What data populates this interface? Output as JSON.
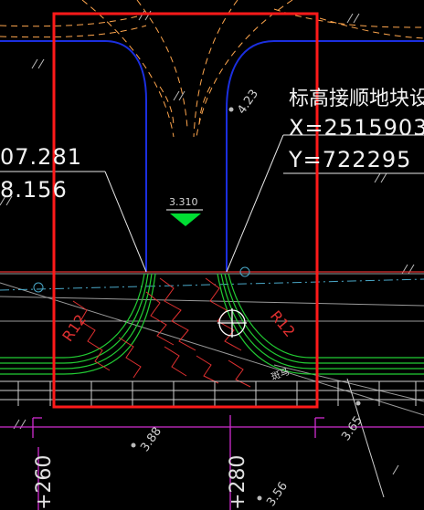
{
  "drawing": {
    "background": "#000000",
    "selection_box_color": "#ff1a1a",
    "text_color": "#f2f2f2",
    "curb_color": "#1b2fe0",
    "road_marking_color": "#ffa64d",
    "green_line_color": "#22cc33",
    "magenta_line_color": "#d02cd0",
    "elevation_marker_color": "#00dd33"
  },
  "labels": {
    "elevation_note": "标高接顺地块设",
    "coord_x_right": "X=2515903",
    "coord_y_right": "Y=722295",
    "coord_left_top": "07.281",
    "coord_left_bottom": "8.156",
    "elevation_marker": "3.310",
    "spot_423": "4.23",
    "spot_388": "3.88",
    "spot_365": "3.65",
    "spot_356": "3.56",
    "chainage_260": "+260",
    "chainage_280": "+280",
    "radius_left": "R12",
    "radius_right": "R12",
    "zebra_note": "斑马"
  }
}
